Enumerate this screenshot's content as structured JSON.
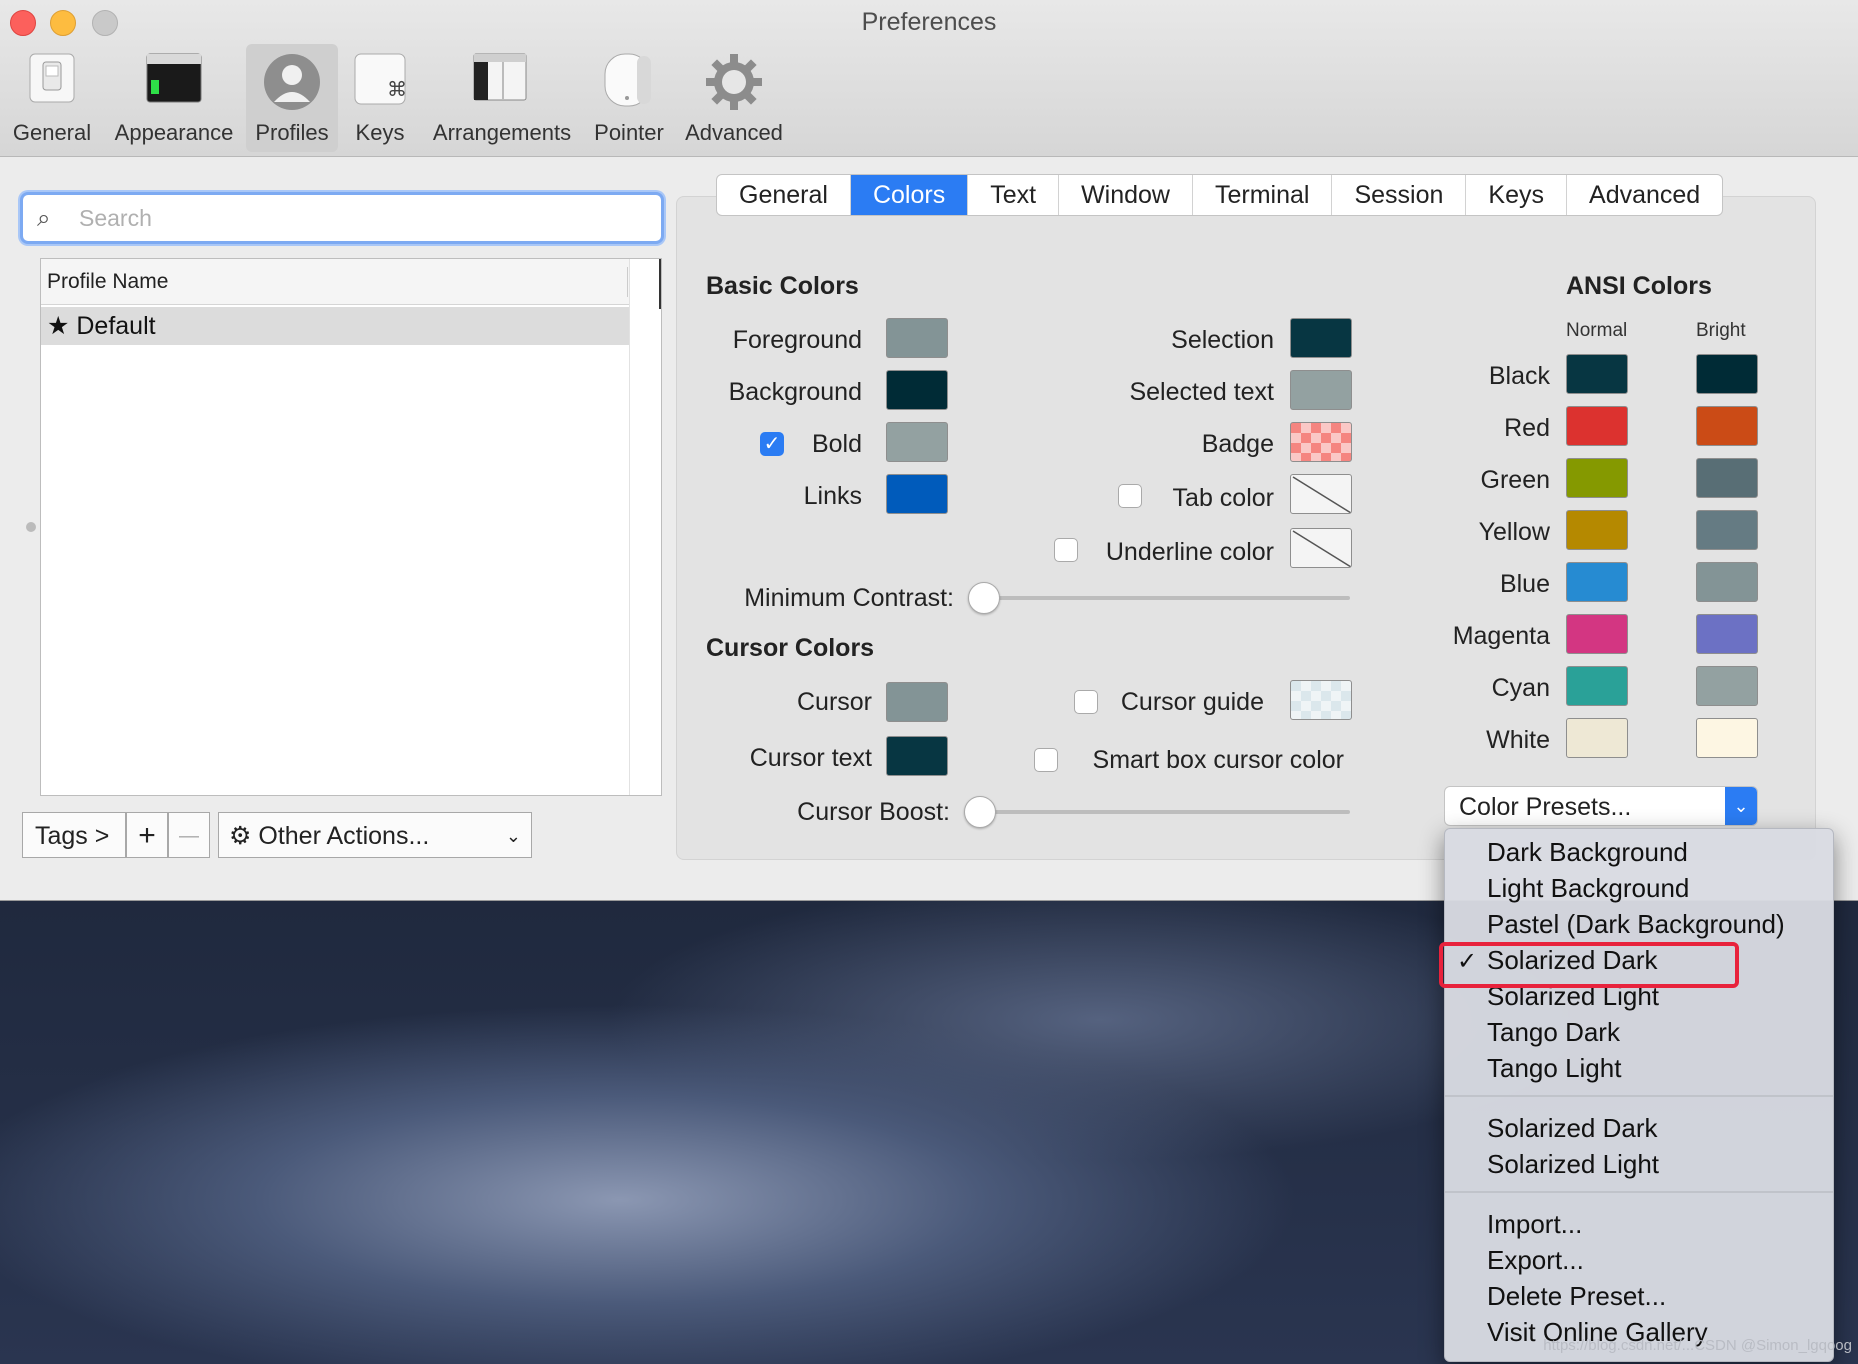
{
  "window": {
    "title": "Preferences"
  },
  "toolbar": [
    {
      "label": "General"
    },
    {
      "label": "Appearance"
    },
    {
      "label": "Profiles"
    },
    {
      "label": "Keys"
    },
    {
      "label": "Arrangements"
    },
    {
      "label": "Pointer"
    },
    {
      "label": "Advanced"
    }
  ],
  "search": {
    "placeholder": "Search"
  },
  "profiles": {
    "header": "Profile Name",
    "rows": [
      {
        "name": "Default"
      }
    ]
  },
  "bottom": {
    "tags": "Tags >",
    "add": "+",
    "remove": "—",
    "other_actions": "Other Actions..."
  },
  "tabs": [
    {
      "label": "General"
    },
    {
      "label": "Colors"
    },
    {
      "label": "Text"
    },
    {
      "label": "Window"
    },
    {
      "label": "Terminal"
    },
    {
      "label": "Session"
    },
    {
      "label": "Keys"
    },
    {
      "label": "Advanced"
    }
  ],
  "basic": {
    "title": "Basic Colors",
    "foreground": "Foreground",
    "background": "Background",
    "bold": "Bold",
    "links": "Links",
    "selection": "Selection",
    "selected_text": "Selected text",
    "badge": "Badge",
    "tab_color": "Tab color",
    "underline_color": "Underline color",
    "min_contrast": "Minimum Contrast:",
    "min_contrast_level": 0,
    "colors": {
      "foreground": "#839496",
      "background": "#002b36",
      "bold": "#93a1a1",
      "links": "#005bbb",
      "selection": "#073642",
      "selected_text": "#93a1a1",
      "badge": "#f58580"
    },
    "bold_checked": true,
    "tab_color_checked": false,
    "underline_checked": false
  },
  "cursor": {
    "title": "Cursor Colors",
    "cursor": "Cursor",
    "cursor_text": "Cursor text",
    "cursor_guide": "Cursor guide",
    "smart_box": "Smart box cursor color",
    "boost": "Cursor Boost:",
    "boost_level": 0,
    "colors": {
      "cursor": "#839496",
      "cursor_text": "#073642",
      "cursor_guide": "#dbe7ec"
    },
    "guide_checked": false,
    "smart_box_checked": false
  },
  "ansi": {
    "title": "ANSI Colors",
    "normal": "Normal",
    "bright": "Bright",
    "rows": [
      {
        "name": "Black",
        "normal": "#073642",
        "bright": "#002b36"
      },
      {
        "name": "Red",
        "normal": "#dc322f",
        "bright": "#cb4b16"
      },
      {
        "name": "Green",
        "normal": "#859900",
        "bright": "#586e75"
      },
      {
        "name": "Yellow",
        "normal": "#b58900",
        "bright": "#657b83"
      },
      {
        "name": "Blue",
        "normal": "#268bd2",
        "bright": "#839496"
      },
      {
        "name": "Magenta",
        "normal": "#d33682",
        "bright": "#6c71c4"
      },
      {
        "name": "Cyan",
        "normal": "#2aa198",
        "bright": "#93a1a1"
      },
      {
        "name": "White",
        "normal": "#eee8d5",
        "bright": "#fdf6e3"
      }
    ]
  },
  "presets": {
    "label": "Color Presets...",
    "group1": [
      "Dark Background",
      "Light Background",
      "Pastel (Dark Background)",
      "Solarized Dark",
      "Solarized Light",
      "Tango Dark",
      "Tango Light"
    ],
    "group2": [
      "Solarized Dark",
      "Solarized Light"
    ],
    "group3": [
      "Import...",
      "Export...",
      "Delete Preset...",
      "Visit Online Gallery"
    ],
    "checked": "Solarized Dark",
    "checkmark": "✓"
  },
  "watermark": "https://blog.csdn.net/...CSDN @Simon_lgqoog"
}
